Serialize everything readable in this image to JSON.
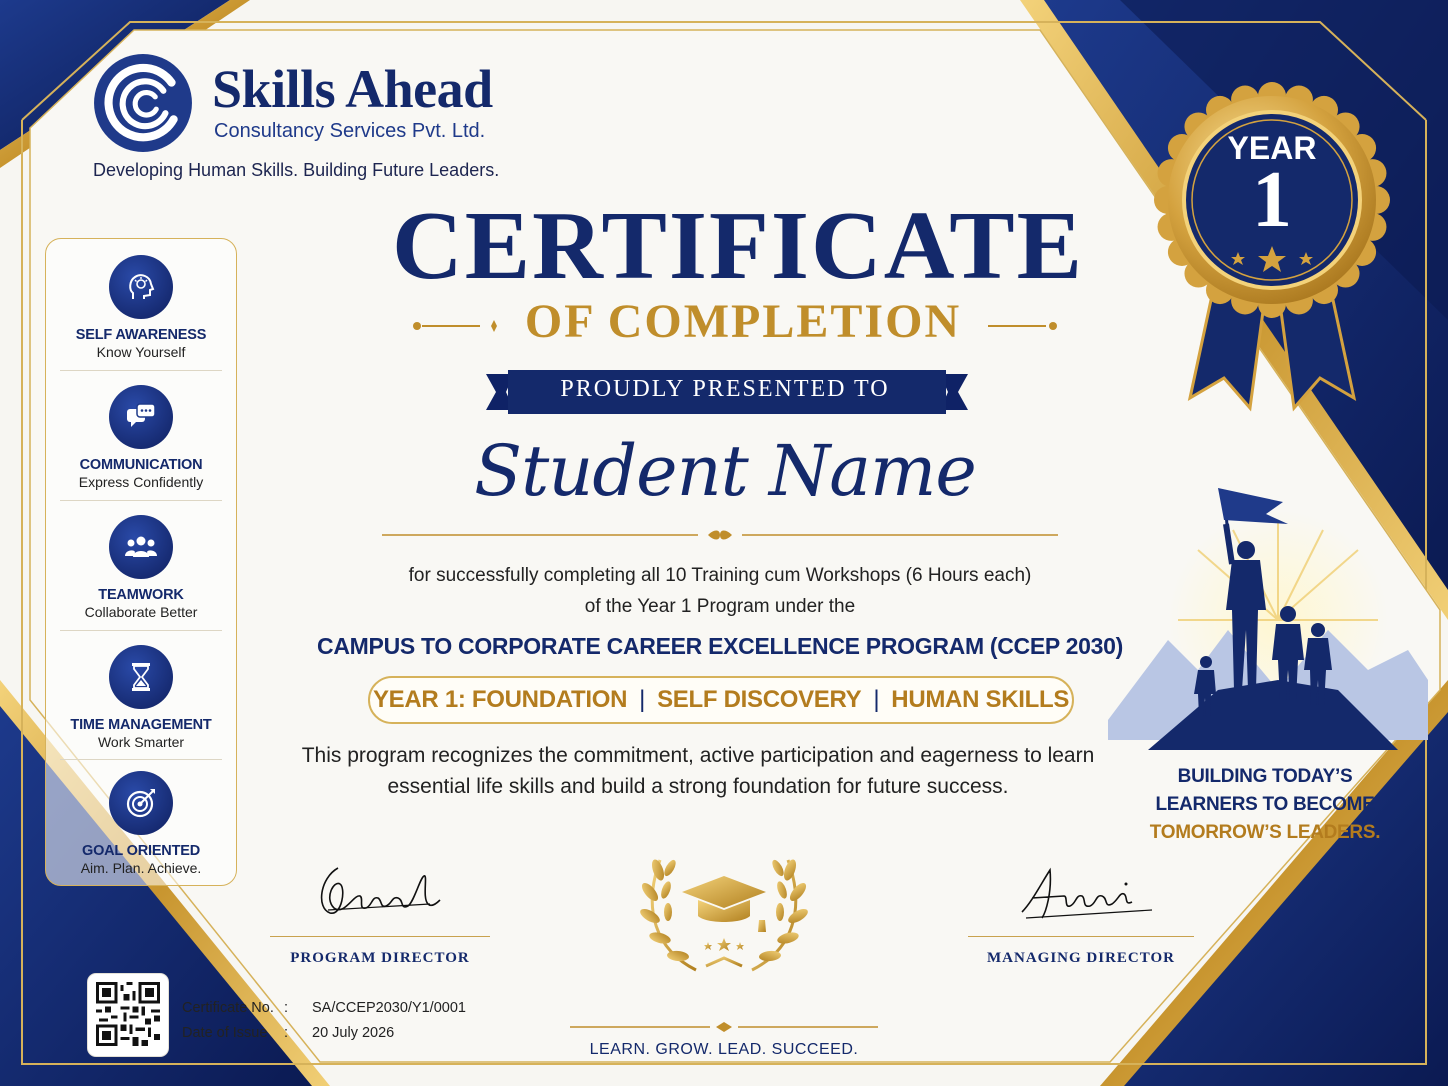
{
  "colors": {
    "navy": "#14296b",
    "gold": "#c08e2b",
    "paper": "#f7f6f2"
  },
  "brand": {
    "name": "Skills Ahead",
    "subtitle": "Consultancy Services Pvt. Ltd.",
    "tagline": "Developing Human Skills. Building Future Leaders.",
    "logo_icon": "swirl-logo-icon"
  },
  "skills": [
    {
      "title": "SELF AWARENESS",
      "subtitle": "Know Yourself",
      "icon": "head-lightbulb-icon"
    },
    {
      "title": "COMMUNICATION",
      "subtitle": "Express Confidently",
      "icon": "chat-bubbles-icon"
    },
    {
      "title": "TEAMWORK",
      "subtitle": "Collaborate Better",
      "icon": "people-group-icon"
    },
    {
      "title": "TIME MANAGEMENT",
      "subtitle": "Work Smarter",
      "icon": "hourglass-icon"
    },
    {
      "title": "GOAL ORIENTED",
      "subtitle": "Aim. Plan. Achieve.",
      "icon": "target-arrow-icon"
    }
  ],
  "certificate": {
    "title": "CERTIFICATE",
    "subtitle": "OF COMPLETION",
    "presented_to": "PROUDLY PRESENTED TO",
    "recipient": "Student Name",
    "body_line1": "for successfully completing all 10 Training cum Workshops (6 Hours each)",
    "body_line2": "of the Year 1 Program under the",
    "program": "CAMPUS TO CORPORATE CAREER EXCELLENCE PROGRAM (CCEP 2030)",
    "year_tags": [
      "YEAR 1: FOUNDATION",
      "SELF DISCOVERY",
      "HUMAN SKILLS"
    ],
    "tag_separator": "|",
    "recognition_line1": "This program recognizes the commitment, active participation and eagerness to learn",
    "recognition_line2": "essential life skills and build a strong foundation for future success."
  },
  "seal": {
    "label": "YEAR",
    "number": "1",
    "icon": "rosette-ribbon-icon"
  },
  "leaders": {
    "line1": "BUILDING TODAY’S",
    "line2": "LEARNERS TO BECOME",
    "line3": "TOMORROW’S LEADERS.",
    "icon": "summit-flag-icon"
  },
  "signatures": {
    "left_label": "PROGRAM DIRECTOR",
    "right_label": "MANAGING DIRECTOR"
  },
  "emblem": {
    "icon": "laurel-graduation-cap-icon"
  },
  "meta": {
    "cert_no_label": "Certificate No.",
    "cert_no": "SA/CCEP2030/Y1/0001",
    "date_label": "Date of Issue",
    "date": "20 July 2026",
    "colon": ":",
    "qr_icon": "qr-code-icon"
  },
  "footer": {
    "motto": "LEARN. GROW. LEAD. SUCCEED."
  }
}
